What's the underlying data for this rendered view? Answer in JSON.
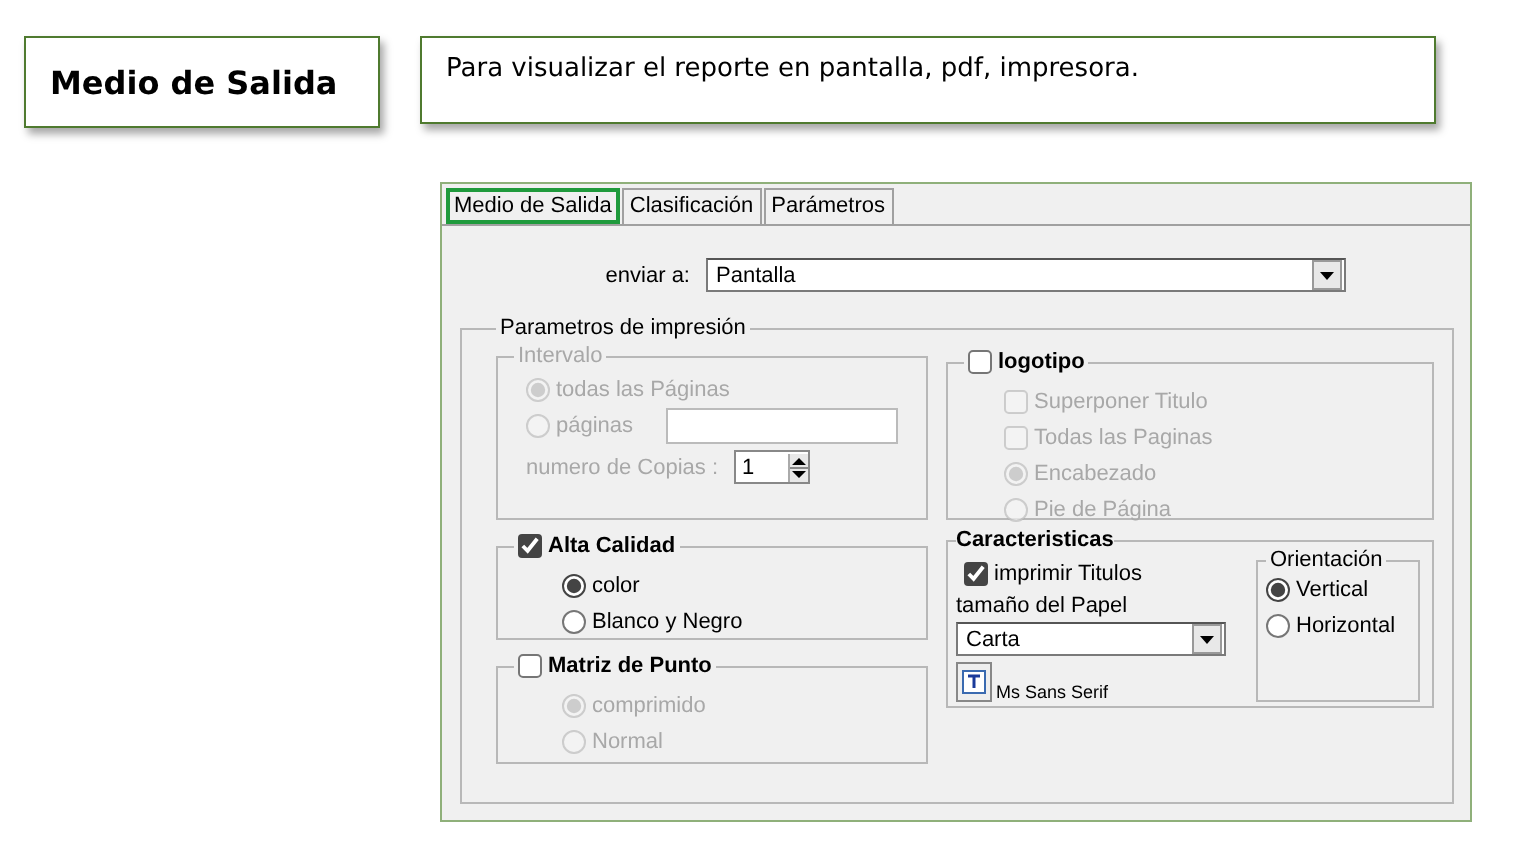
{
  "header": {
    "title": "Medio de Salida",
    "description": "Para visualizar el reporte en pantalla, pdf, impresora."
  },
  "tabs": [
    {
      "label": "Medio de Salida",
      "selected": true
    },
    {
      "label": "Clasificación",
      "selected": false
    },
    {
      "label": "Parámetros",
      "selected": false
    }
  ],
  "send_to": {
    "label": "enviar a:",
    "value": "Pantalla"
  },
  "print_params": {
    "title": "Parametros de impresión",
    "interval": {
      "title": "Intervalo",
      "disabled": true,
      "options": [
        {
          "label": "todas las Páginas",
          "selected": true
        },
        {
          "label": "páginas",
          "selected": false
        }
      ],
      "copies": {
        "label": "numero de Copias :",
        "value": "1"
      }
    },
    "high_quality": {
      "label": "Alta Calidad",
      "checked": true,
      "disabled": false,
      "options": [
        {
          "label": "color",
          "selected": true
        },
        {
          "label": "Blanco y Negro",
          "selected": false
        }
      ]
    },
    "dot_matrix": {
      "label": "Matriz de Punto",
      "checked": false,
      "disabled": true,
      "options": [
        {
          "label": "comprimido",
          "selected": true
        },
        {
          "label": "Normal",
          "selected": false
        }
      ]
    },
    "logo": {
      "label": "logotipo",
      "checked": false,
      "disabled": true,
      "items": [
        {
          "kind": "checkbox",
          "label": "Superponer Titulo",
          "checked": false
        },
        {
          "kind": "checkbox",
          "label": "Todas las Paginas",
          "checked": false
        },
        {
          "kind": "radio",
          "label": "Encabezado",
          "selected": true
        },
        {
          "kind": "radio",
          "label": "Pie de Página",
          "selected": false
        }
      ]
    },
    "features": {
      "title": "Caracteristicas",
      "print_titles": {
        "label": "imprimir Titulos",
        "checked": true
      },
      "paper_size": {
        "label": "tamaño del Papel",
        "value": "Carta"
      },
      "font_name": "Ms Sans Serif",
      "orientation": {
        "title": "Orientación",
        "options": [
          {
            "label": "Vertical",
            "selected": true
          },
          {
            "label": "Horizontal",
            "selected": false
          }
        ]
      }
    }
  }
}
